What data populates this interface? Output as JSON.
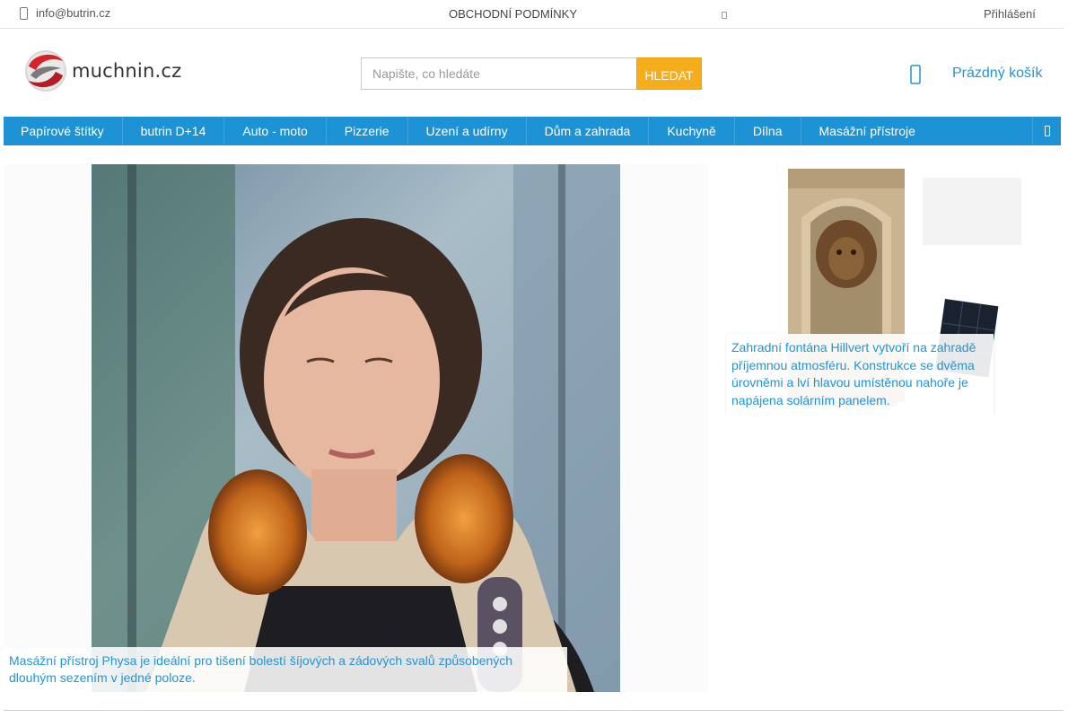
{
  "topbar": {
    "email": "info@butrin.cz",
    "terms_link": "OBCHODNÍ PODMÍNKY",
    "login_link": "Přihlášení"
  },
  "header": {
    "logo_text": "muchnin.cz",
    "search_placeholder": "Napište, co hledáte",
    "search_button": "HLEDAT",
    "cart_label": "Prázdný košík"
  },
  "nav": {
    "items": [
      "Papírové štítky",
      "butrin D+14",
      "Auto - moto",
      "Pizzerie",
      "Uzení a udírny",
      "Dům a zahrada",
      "Kuchyně",
      "Dílna",
      "Masážní přístroje"
    ]
  },
  "banners": {
    "main_caption": "Masážní přístroj Physa je ideální pro tišení bolestí šíjových a zádových svalů způsobených dlouhým sezením v jedné poloze.",
    "side_caption": "Zahradní fontána Hillvert vytvoří na zahradě příjemnou atmosféru. Konstrukce se dvěma úrovněmi a lví hlavou umístěnou nahoře je napájena solárním panelem."
  },
  "colors": {
    "accent_blue": "#1d93d6",
    "search_button": "#f6ad1c",
    "link_blue": "#1f95d6"
  }
}
